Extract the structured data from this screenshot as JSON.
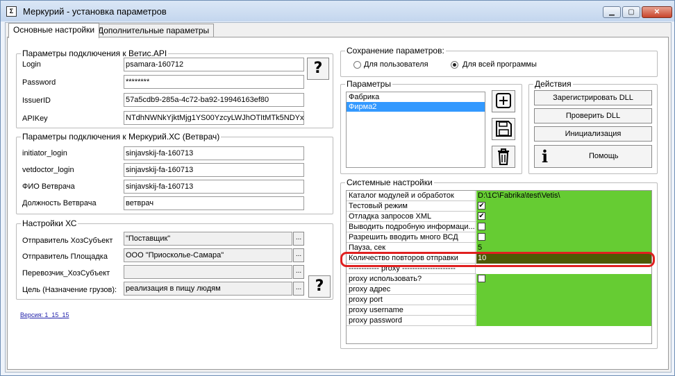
{
  "window": {
    "title": "Меркурий - установка параметров",
    "icon": "app-icon"
  },
  "tabs": [
    "Основные настройки",
    "Дополнительные параметры"
  ],
  "vetis": {
    "title": "Параметры подключения к Ветис.API",
    "labels": [
      "Login",
      "Password",
      "IssuerID",
      "APIKey"
    ],
    "values": [
      "psamara-160712",
      "********",
      "57a5cdb9-285a-4c72-ba92-19946163ef80",
      "NTdhNWNkYjktMjg1YS00YzcyLWJhOTItMTk5NDYx"
    ],
    "help": "?"
  },
  "mercury": {
    "title": "Параметры подключения к Меркурий.ХС (Ветврач)",
    "labels": [
      "initiator_login",
      "vetdoctor_login",
      "ФИО Ветврача",
      "Должность Ветврача"
    ],
    "values": [
      "sinjavskij-fa-160713",
      "sinjavskij-fa-160713",
      "sinjavskij-fa-160713",
      "ветврач"
    ]
  },
  "xs": {
    "title": "Настройки ХС",
    "labels": [
      "Отправитель ХозСубъект",
      "Отправитель Площадка",
      "Перевозчик_ХозСубъект",
      "Цель (Назначение грузов):"
    ],
    "values": [
      "\"Поставщик\"",
      "ООО \"Приосколье-Самара\"",
      "",
      "реализация в пищу людям"
    ],
    "help": "?"
  },
  "version": "Версия: 1_15_15",
  "save": {
    "title": "Сохранение параметров:",
    "options": [
      "Для пользователя",
      "Для всей программы"
    ],
    "selected": 1
  },
  "params": {
    "title": "Параметры",
    "items": [
      "Фабрика",
      "Фирма2"
    ],
    "selected": 1
  },
  "actions": {
    "title": "Действия",
    "buttons": [
      "Зарегистрировать DLL",
      "Проверить DLL",
      "Инициализация",
      "Помощь"
    ]
  },
  "system": {
    "title": "Системные настройки",
    "rows": [
      {
        "name": "Каталог модулей  и обработок",
        "value": "D:\\1C\\Fabrika\\test\\Vetis\\",
        "kind": "text"
      },
      {
        "name": "Тестовый режим",
        "value": "✔",
        "kind": "check"
      },
      {
        "name": "Отладка запросов XML",
        "value": "✔",
        "kind": "check"
      },
      {
        "name": "Выводить подробную информаци...",
        "value": "",
        "kind": "check"
      },
      {
        "name": "Разрешить вводить много ВСД",
        "value": "",
        "kind": "check"
      },
      {
        "name": "Пауза, сек",
        "value": "5",
        "kind": "text"
      },
      {
        "name": "Количество повторов отправки",
        "value": "10",
        "kind": "dark"
      },
      {
        "name": "------------ proxy ---------------------",
        "value": "",
        "kind": "white"
      },
      {
        "name": "proxy использовать?",
        "value": "",
        "kind": "check"
      },
      {
        "name": "proxy адрес",
        "value": "",
        "kind": "text"
      },
      {
        "name": "proxy port",
        "value": "",
        "kind": "text"
      },
      {
        "name": "proxy username",
        "value": "",
        "kind": "text"
      },
      {
        "name": "proxy password",
        "value": "",
        "kind": "text"
      }
    ]
  }
}
